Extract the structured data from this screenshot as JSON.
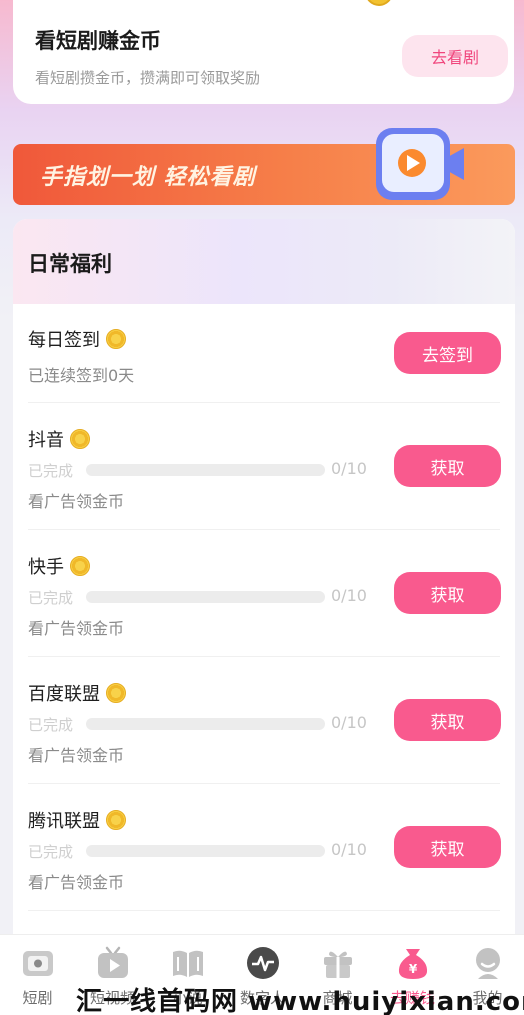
{
  "top_card": {
    "title": "看短剧赚金币",
    "subtitle": "看短剧攒金币，攒满即可领取奖励",
    "button": "去看剧"
  },
  "banner": {
    "text": "手指划一划 轻松看剧"
  },
  "daily": {
    "title": "日常福利",
    "tasks": [
      {
        "name": "每日签到",
        "sub": "已连续签到0天",
        "button": "去签到"
      },
      {
        "name": "抖音",
        "status": "已完成",
        "progress": "0/10",
        "progress_fraction": 0,
        "sub": "看广告领金币",
        "button": "获取"
      },
      {
        "name": "快手",
        "status": "已完成",
        "progress": "0/10",
        "progress_fraction": 0,
        "sub": "看广告领金币",
        "button": "获取"
      },
      {
        "name": "百度联盟",
        "status": "已完成",
        "progress": "0/10",
        "progress_fraction": 0,
        "sub": "看广告领金币",
        "button": "获取"
      },
      {
        "name": "腾讯联盟",
        "status": "已完成",
        "progress": "0/10",
        "progress_fraction": 0,
        "sub": "看广告领金币",
        "button": "获取"
      }
    ]
  },
  "nav": [
    {
      "label": "短剧",
      "icon": "tv-icon"
    },
    {
      "label": "短视频",
      "icon": "video-icon"
    },
    {
      "label": "小说",
      "icon": "book-icon"
    },
    {
      "label": "数字人",
      "icon": "pulse-icon"
    },
    {
      "label": "商城",
      "icon": "gift-icon"
    },
    {
      "label": "去赚钱",
      "icon": "money-bag-icon",
      "active": true
    },
    {
      "label": "我的",
      "icon": "profile-icon"
    }
  ],
  "watermark": "汇一线首码网 www.huiyixian.com",
  "colors": {
    "accent": "#f95a8e",
    "banner": "#f0583a"
  }
}
